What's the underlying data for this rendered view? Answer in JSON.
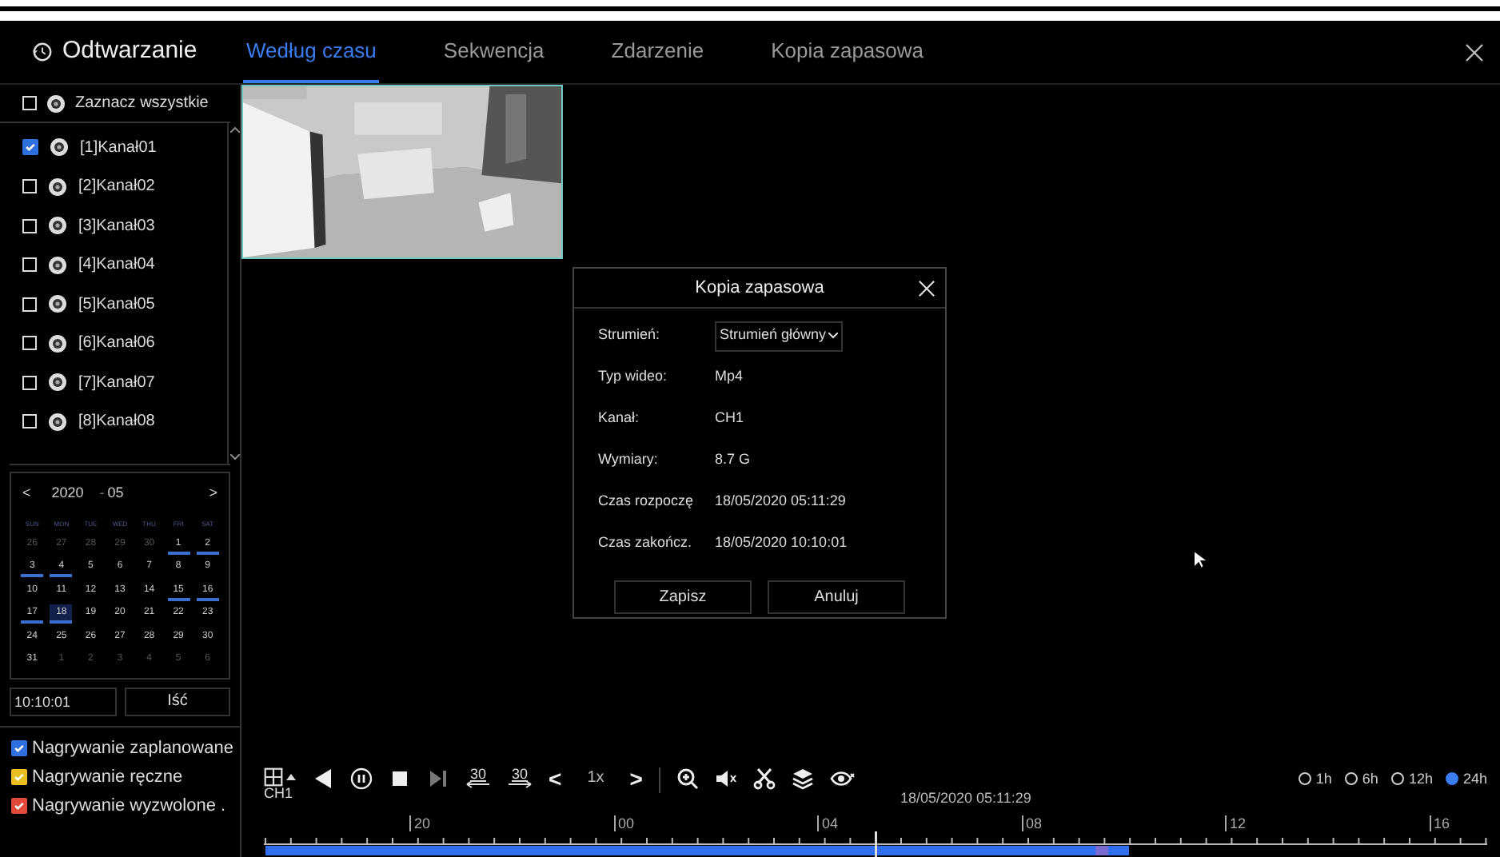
{
  "header": {
    "title": "Odtwarzanie",
    "tabs": [
      {
        "label": "Według czasu",
        "selected": true
      },
      {
        "label": "Sekwencja",
        "selected": false
      },
      {
        "label": "Zdarzenie",
        "selected": false
      },
      {
        "label": "Kopia zapasowa",
        "selected": false
      }
    ]
  },
  "channels": {
    "select_all": {
      "label": "Zaznacz wszystkie",
      "checked": false
    },
    "items": [
      {
        "label": "[1]Kanał01",
        "checked": true
      },
      {
        "label": "[2]Kanał02",
        "checked": false
      },
      {
        "label": "[3]Kanał03",
        "checked": false
      },
      {
        "label": "[4]Kanał04",
        "checked": false
      },
      {
        "label": "[5]Kanał05",
        "checked": false
      },
      {
        "label": "[6]Kanał06",
        "checked": false
      },
      {
        "label": "[7]Kanał07",
        "checked": false
      },
      {
        "label": "[8]Kanał08",
        "checked": false
      }
    ]
  },
  "calendar": {
    "year": "2020",
    "separator": "-",
    "month": "05",
    "prev": "<",
    "next": ">",
    "weekdays": [
      "SUN",
      "MON",
      "TUE",
      "WED",
      "THU",
      "FRI",
      "SAT"
    ],
    "days": [
      {
        "label": "26",
        "other": true,
        "recorded": false,
        "selected": false
      },
      {
        "label": "27",
        "other": true,
        "recorded": false,
        "selected": false
      },
      {
        "label": "28",
        "other": true,
        "recorded": false,
        "selected": false
      },
      {
        "label": "29",
        "other": true,
        "recorded": false,
        "selected": false
      },
      {
        "label": "30",
        "other": true,
        "recorded": false,
        "selected": false
      },
      {
        "label": "1",
        "other": false,
        "recorded": true,
        "selected": false
      },
      {
        "label": "2",
        "other": false,
        "recorded": true,
        "selected": false
      },
      {
        "label": "3",
        "other": false,
        "recorded": true,
        "selected": false
      },
      {
        "label": "4",
        "other": false,
        "recorded": true,
        "selected": false
      },
      {
        "label": "5",
        "other": false,
        "recorded": false,
        "selected": false
      },
      {
        "label": "6",
        "other": false,
        "recorded": false,
        "selected": false
      },
      {
        "label": "7",
        "other": false,
        "recorded": false,
        "selected": false
      },
      {
        "label": "8",
        "other": false,
        "recorded": false,
        "selected": false
      },
      {
        "label": "9",
        "other": false,
        "recorded": false,
        "selected": false
      },
      {
        "label": "10",
        "other": false,
        "recorded": false,
        "selected": false
      },
      {
        "label": "11",
        "other": false,
        "recorded": false,
        "selected": false
      },
      {
        "label": "12",
        "other": false,
        "recorded": false,
        "selected": false
      },
      {
        "label": "13",
        "other": false,
        "recorded": false,
        "selected": false
      },
      {
        "label": "14",
        "other": false,
        "recorded": false,
        "selected": false
      },
      {
        "label": "15",
        "other": false,
        "recorded": true,
        "selected": false
      },
      {
        "label": "16",
        "other": false,
        "recorded": true,
        "selected": false
      },
      {
        "label": "17",
        "other": false,
        "recorded": true,
        "selected": false
      },
      {
        "label": "18",
        "other": false,
        "recorded": true,
        "selected": true
      },
      {
        "label": "19",
        "other": false,
        "recorded": false,
        "selected": false
      },
      {
        "label": "20",
        "other": false,
        "recorded": false,
        "selected": false
      },
      {
        "label": "21",
        "other": false,
        "recorded": false,
        "selected": false
      },
      {
        "label": "22",
        "other": false,
        "recorded": false,
        "selected": false
      },
      {
        "label": "23",
        "other": false,
        "recorded": false,
        "selected": false
      },
      {
        "label": "24",
        "other": false,
        "recorded": false,
        "selected": false
      },
      {
        "label": "25",
        "other": false,
        "recorded": false,
        "selected": false
      },
      {
        "label": "26",
        "other": false,
        "recorded": false,
        "selected": false
      },
      {
        "label": "27",
        "other": false,
        "recorded": false,
        "selected": false
      },
      {
        "label": "28",
        "other": false,
        "recorded": false,
        "selected": false
      },
      {
        "label": "29",
        "other": false,
        "recorded": false,
        "selected": false
      },
      {
        "label": "30",
        "other": false,
        "recorded": false,
        "selected": false
      },
      {
        "label": "31",
        "other": false,
        "recorded": false,
        "selected": false
      },
      {
        "label": "1",
        "other": true,
        "recorded": false,
        "selected": false
      },
      {
        "label": "2",
        "other": true,
        "recorded": false,
        "selected": false
      },
      {
        "label": "3",
        "other": true,
        "recorded": false,
        "selected": false
      },
      {
        "label": "4",
        "other": true,
        "recorded": false,
        "selected": false
      },
      {
        "label": "5",
        "other": true,
        "recorded": false,
        "selected": false
      },
      {
        "label": "6",
        "other": true,
        "recorded": false,
        "selected": false
      }
    ]
  },
  "time_field": {
    "value": "10:10:01",
    "button": "Iść"
  },
  "legend": [
    {
      "label": "Nagrywanie zaplanowane",
      "color": "#2f6fe0",
      "checked": true
    },
    {
      "label": "Nagrywanie ręczne",
      "color": "#e8c020",
      "checked": true
    },
    {
      "label": "Nagrywanie wyzwolone .",
      "color": "#e04a3a",
      "checked": true
    }
  ],
  "dialog": {
    "title": "Kopia zapasowa",
    "fields": [
      {
        "kind": "select",
        "label": "Strumień:",
        "value": "Strumień główny"
      },
      {
        "kind": "text",
        "label": "Typ wideo:",
        "value": "Mp4"
      },
      {
        "kind": "text",
        "label": "Kanał:",
        "value": "CH1"
      },
      {
        "kind": "text",
        "label": "Wymiary:",
        "value": "8.7 G"
      },
      {
        "kind": "text",
        "label": "Czas rozpoczę",
        "value": "18/05/2020 05:11:29"
      },
      {
        "kind": "text",
        "label": "Czas zakończ.",
        "value": "18/05/2020 10:10:01"
      }
    ],
    "buttons": [
      "Zapisz",
      "Anuluj"
    ]
  },
  "toolbar": {
    "channel": "CH1",
    "skip_back": "30",
    "skip_forward": "30",
    "speed_prev": "<",
    "speed": "1x",
    "speed_next": ">",
    "timestamp": "18/05/2020 05:11:29"
  },
  "timeline": {
    "hour_labels": [
      "20",
      "00",
      "04",
      "08",
      "12",
      "16"
    ]
  },
  "ranges": [
    {
      "label": "1h",
      "selected": false
    },
    {
      "label": "6h",
      "selected": false
    },
    {
      "label": "12h",
      "selected": false
    },
    {
      "label": "24h",
      "selected": true
    }
  ]
}
